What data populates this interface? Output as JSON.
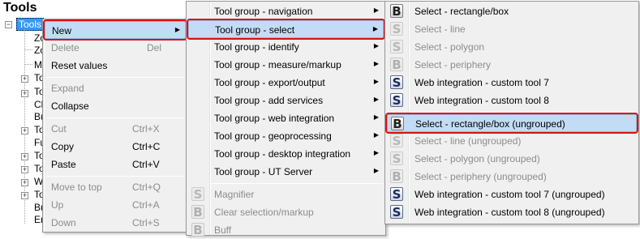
{
  "panel": {
    "title": "Tools",
    "root_label": "Tools",
    "tree_labels": [
      "Zo",
      "Zo",
      "M",
      "To",
      "To",
      "Cl",
      "Bu",
      "To",
      "Fu",
      "To",
      "To",
      "Wi",
      "To",
      "Bu",
      "Er"
    ]
  },
  "context_menu": {
    "items": [
      {
        "label": "New",
        "shortcut": "",
        "submenu": true,
        "state": "highlighted"
      },
      {
        "label": "Delete",
        "shortcut": "Del",
        "state": "disabled"
      },
      {
        "label": "Reset values",
        "shortcut": "",
        "state": "enabled"
      },
      {
        "label": "Expand",
        "shortcut": "",
        "state": "disabled"
      },
      {
        "label": "Collapse",
        "shortcut": "",
        "state": "enabled"
      },
      {
        "label": "Cut",
        "shortcut": "Ctrl+X",
        "state": "disabled"
      },
      {
        "label": "Copy",
        "shortcut": "Ctrl+C",
        "state": "enabled"
      },
      {
        "label": "Paste",
        "shortcut": "Ctrl+V",
        "state": "enabled"
      },
      {
        "label": "Move to top",
        "shortcut": "Ctrl+Q",
        "state": "disabled"
      },
      {
        "label": "Up",
        "shortcut": "Ctrl+A",
        "state": "disabled"
      },
      {
        "label": "Down",
        "shortcut": "Ctrl+S",
        "state": "disabled"
      }
    ]
  },
  "new_submenu": {
    "items": [
      {
        "label": "Tool group - navigation"
      },
      {
        "label": "Tool group - select",
        "state": "highlighted"
      },
      {
        "label": "Tool group - identify"
      },
      {
        "label": "Tool group - measure/markup"
      },
      {
        "label": "Tool group - export/output"
      },
      {
        "label": "Tool group - add services"
      },
      {
        "label": "Tool group - web integration"
      },
      {
        "label": "Tool group - geoprocessing"
      },
      {
        "label": "Tool group - desktop integration"
      },
      {
        "label": "Tool group - UT Server"
      },
      {
        "label": "Magnifier",
        "icon": "S",
        "state": "disabled"
      },
      {
        "label": "Clear selection/markup",
        "icon": "B",
        "state": "disabled"
      },
      {
        "label": "Buff",
        "icon": "B",
        "state": "disabled"
      }
    ]
  },
  "select_submenu": {
    "items": [
      {
        "label": "Select - rectangle/box",
        "icon": "B",
        "state": "enabled"
      },
      {
        "label": "Select - line",
        "icon": "S",
        "state": "disabled"
      },
      {
        "label": "Select - polygon",
        "icon": "S",
        "state": "disabled"
      },
      {
        "label": "Select - periphery",
        "icon": "B",
        "state": "disabled"
      },
      {
        "label": "Web integration - custom tool 7",
        "icon": "S",
        "state": "enabled"
      },
      {
        "label": "Web integration - custom tool 8",
        "icon": "S",
        "state": "enabled"
      },
      {
        "label": "Select - rectangle/box (ungrouped)",
        "icon": "B",
        "state": "highlighted"
      },
      {
        "label": "Select - line (ungrouped)",
        "icon": "S",
        "state": "disabled"
      },
      {
        "label": "Select - polygon (ungrouped)",
        "icon": "S",
        "state": "disabled"
      },
      {
        "label": "Select - periphery (ungrouped)",
        "icon": "B",
        "state": "disabled"
      },
      {
        "label": "Web integration - custom tool 7 (ungrouped)",
        "icon": "S",
        "state": "enabled"
      },
      {
        "label": "Web integration - custom tool 8 (ungrouped)",
        "icon": "S",
        "state": "enabled"
      }
    ]
  },
  "colors": {
    "highlight": "#c3dcf5",
    "highlight_border": "#92b8e3",
    "annotation_red": "#e01010",
    "menu_bg": "#f0f0f0",
    "selection_blue": "#3399ff"
  }
}
